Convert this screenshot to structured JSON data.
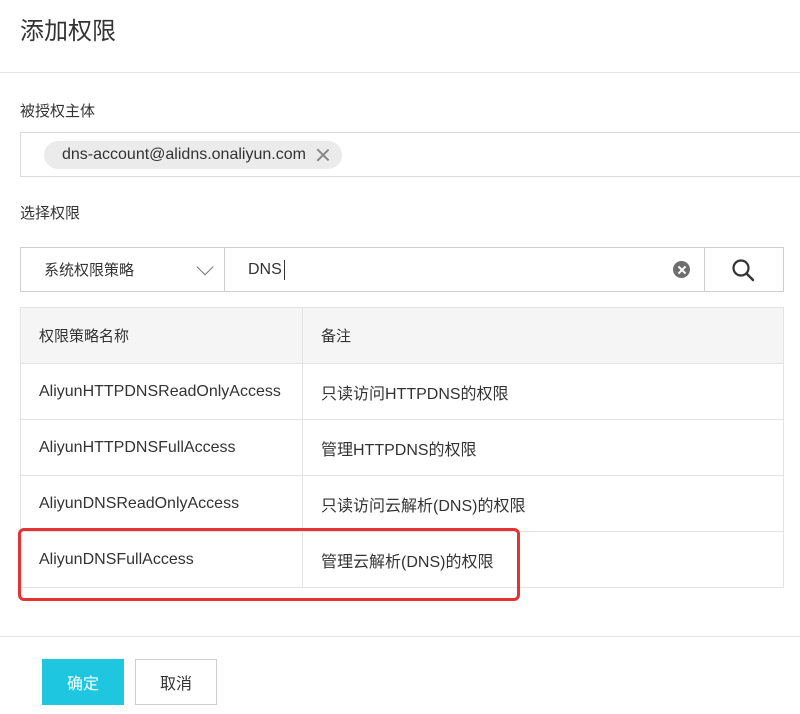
{
  "dialog": {
    "title": "添加权限"
  },
  "grantee": {
    "label": "被授权主体",
    "tags": [
      "dns-account@alidns.onaliyun.com"
    ]
  },
  "permission": {
    "label": "选择权限",
    "policy_type": "系统权限策略",
    "search_value": "DNS"
  },
  "table": {
    "headers": {
      "name": "权限策略名称",
      "note": "备注"
    },
    "rows": [
      {
        "name": "AliyunHTTPDNSReadOnlyAccess",
        "note": "只读访问HTTPDNS的权限"
      },
      {
        "name": "AliyunHTTPDNSFullAccess",
        "note": "管理HTTPDNS的权限"
      },
      {
        "name": "AliyunDNSReadOnlyAccess",
        "note": "只读访问云解析(DNS)的权限"
      },
      {
        "name": "AliyunDNSFullAccess",
        "note": "管理云解析(DNS)的权限"
      }
    ]
  },
  "footer": {
    "confirm_label": "确定",
    "cancel_label": "取消"
  },
  "colors": {
    "primary": "#1ec6e0",
    "highlight": "#e53232"
  },
  "icons": {
    "clear": "clear-circle-icon",
    "search": "search-icon",
    "tag_remove": "close-icon",
    "dropdown": "chevron-down-icon"
  }
}
